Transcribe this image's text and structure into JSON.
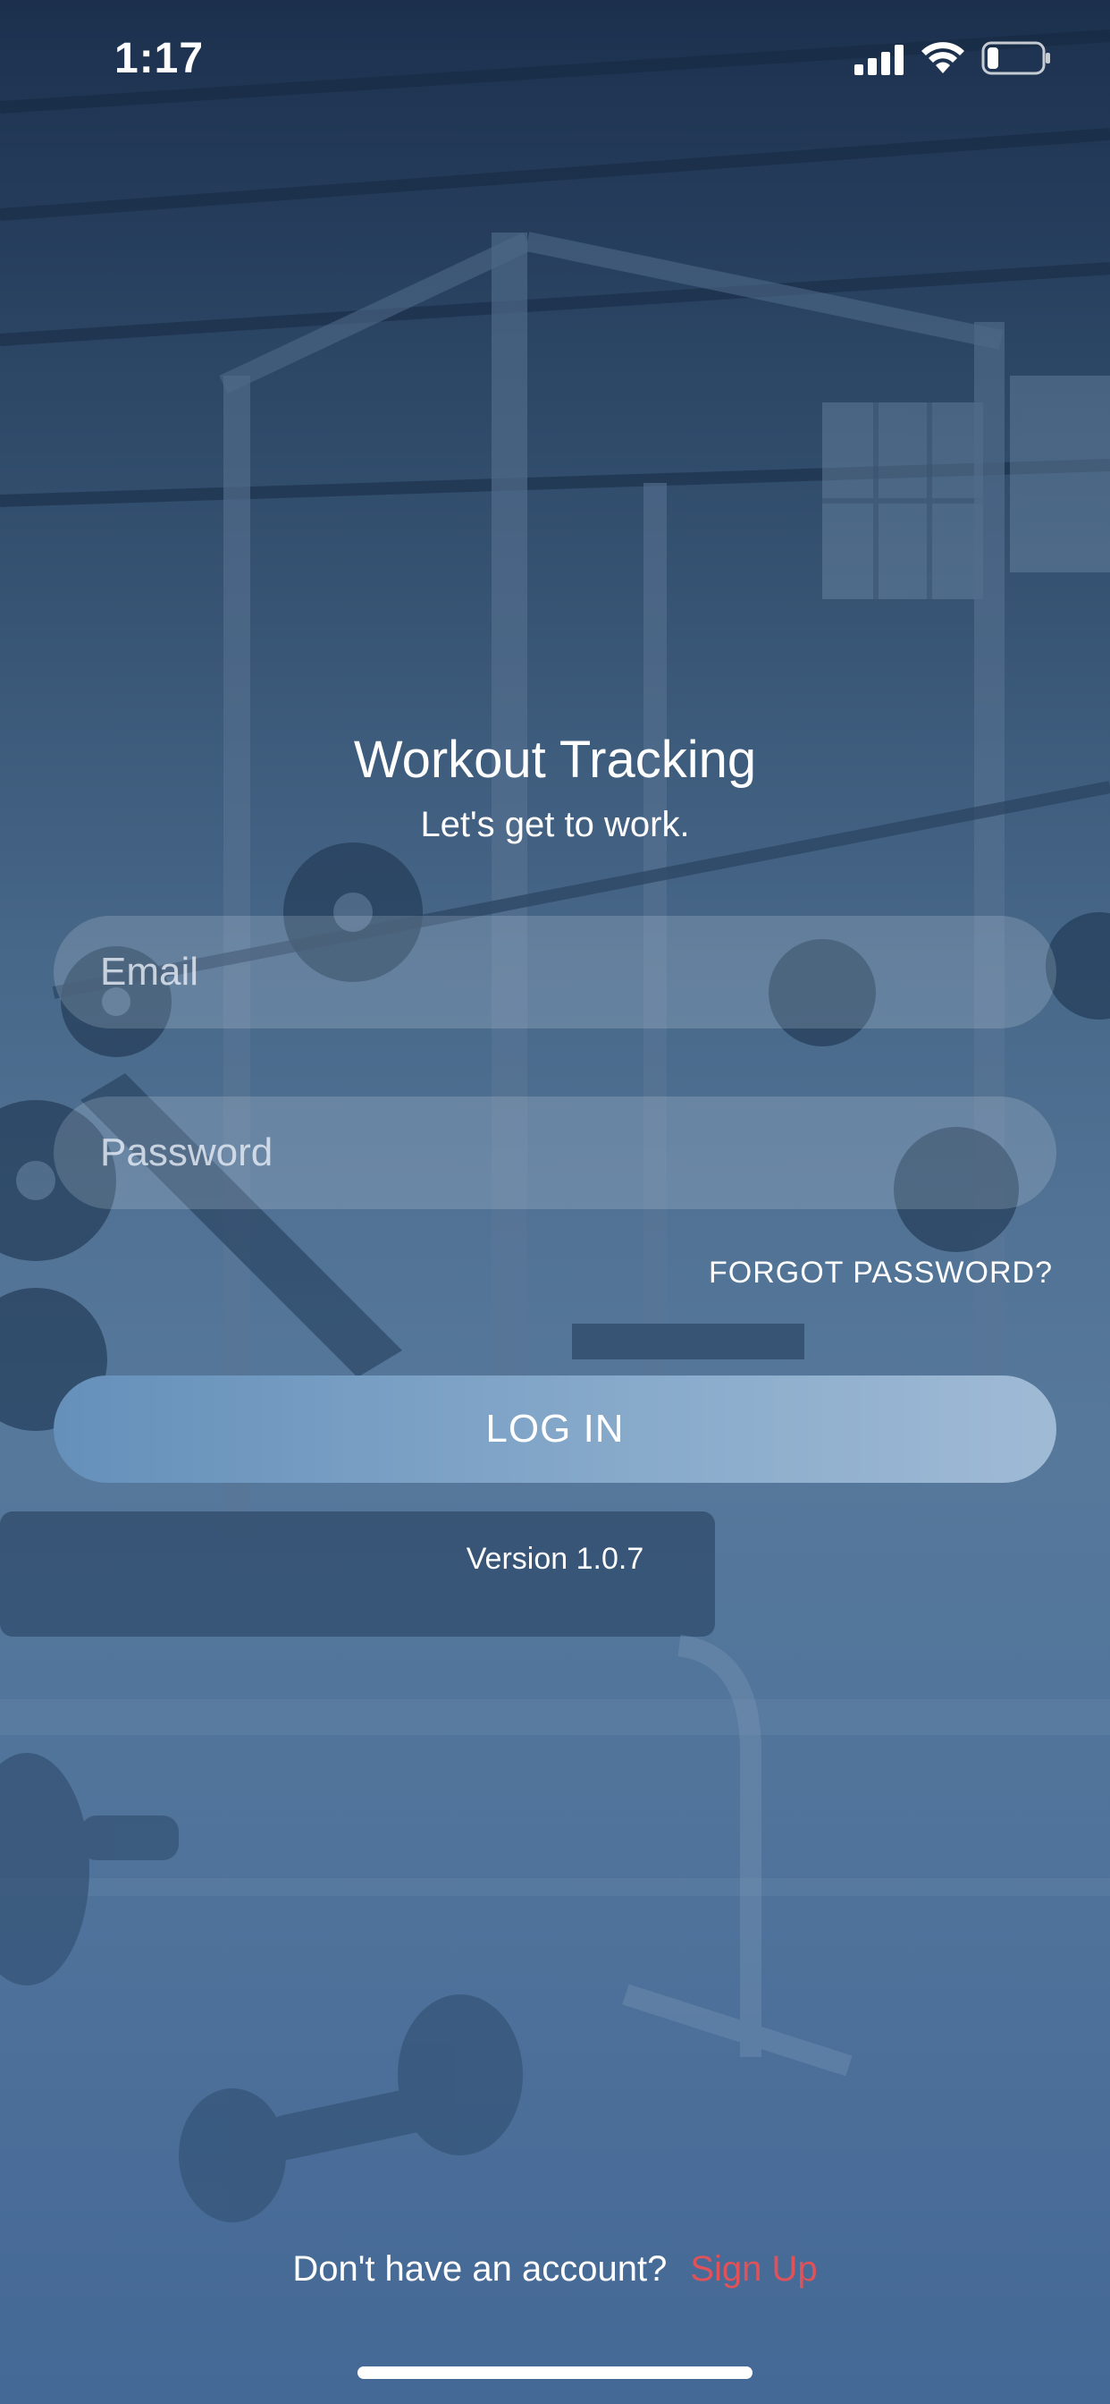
{
  "status_bar": {
    "time": "1:17",
    "icons": [
      "signal-icon",
      "wifi-icon",
      "battery-icon"
    ]
  },
  "header": {
    "title": "Workout Tracking",
    "subtitle": "Let's get to work."
  },
  "form": {
    "email_placeholder": "Email",
    "email_value": "",
    "password_placeholder": "Password",
    "password_value": "",
    "forgot_password_label": "FORGOT PASSWORD?",
    "login_label": "LOG IN"
  },
  "version": "Version 1.0.7",
  "footer": {
    "prompt": "Don't have an account?",
    "signup_label": "Sign Up"
  },
  "colors": {
    "accent_link": "#e0525a",
    "button_gradient_start": "#6590ba",
    "button_gradient_end": "#9fbad5",
    "background": "#4c6c8d"
  }
}
